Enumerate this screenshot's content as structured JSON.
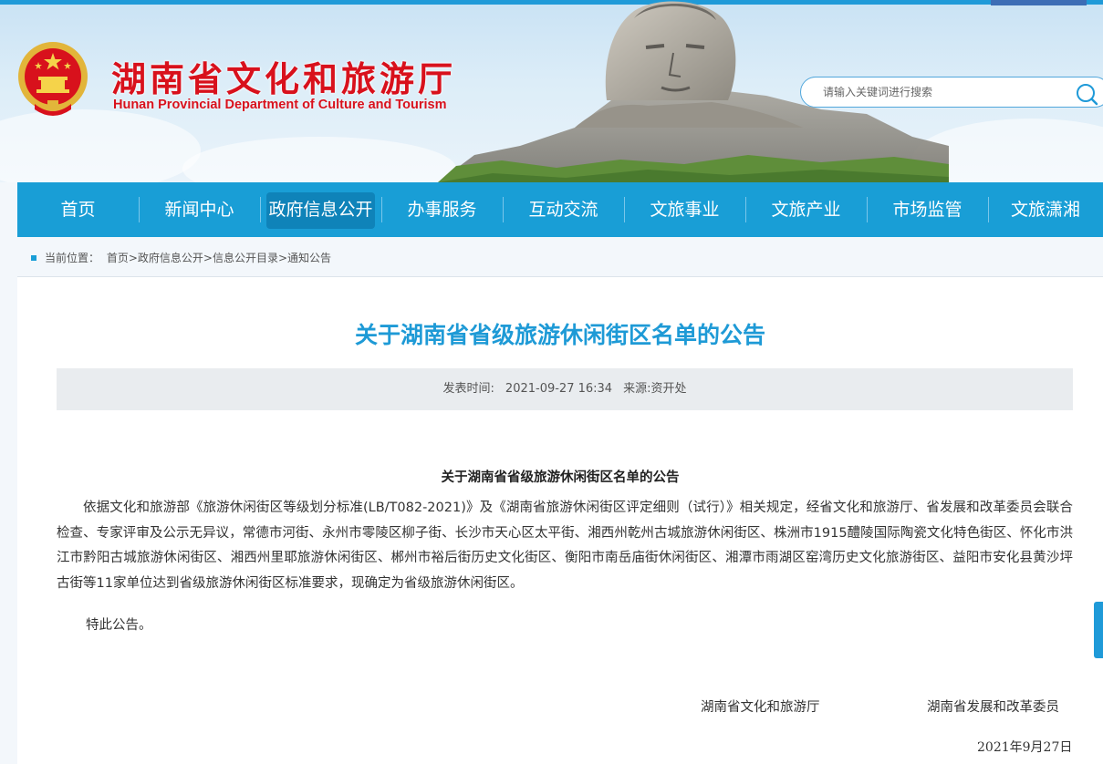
{
  "header": {
    "title_cn": "湖南省文化和旅游厅",
    "title_en": "Hunan Provincial Department of Culture and Tourism"
  },
  "search": {
    "placeholder": "请输入关键词进行搜索"
  },
  "nav": {
    "items": [
      "首页",
      "新闻中心",
      "政府信息公开",
      "办事服务",
      "互动交流",
      "文旅事业",
      "文旅产业",
      "市场监管",
      "文旅潇湘"
    ],
    "active_index": 2
  },
  "breadcrumb": {
    "label": "当前位置：",
    "path": "首页>政府信息公开>信息公开目录>通知公告"
  },
  "article": {
    "title": "关于湖南省省级旅游休闲街区名单的公告",
    "publish_label": "发表时间:",
    "publish_time": "2021-09-27 16:34",
    "source": "来源:资开处",
    "body_title": "关于湖南省省级旅游休闲街区名单的公告",
    "paragraph": "依据文化和旅游部《旅游休闲街区等级划分标准(LB/T082-2021)》及《湖南省旅游休闲街区评定细则（试行）》相关规定，经省文化和旅游厅、省发展和改革委员会联合检查、专家评审及公示无异议，常德市河街、永州市零陵区柳子街、长沙市天心区太平街、湘西州乾州古城旅游休闲街区、株洲市1915醴陵国际陶瓷文化特色街区、怀化市洪江市黔阳古城旅游休闲街区、湘西州里耶旅游休闲街区、郴州市裕后街历史文化街区、衡阳市南岳庙街休闲街区、湘潭市雨湖区窑湾历史文化旅游街区、益阳市安化县黄沙坪古街等11家单位达到省级旅游休闲街区标准要求，现确定为省级旅游休闲街区。",
    "closing": "特此公告。",
    "signer_1": "湖南省文化和旅游厅",
    "signer_2": "湖南省发展和改革委员",
    "date": "2021年9月27日"
  },
  "colors": {
    "brand_red": "#d8111c",
    "nav_blue": "#199ed6",
    "nav_active": "#0f83b9",
    "title_blue": "#1e9ad6"
  },
  "icons": [
    "national-emblem-icon",
    "search-icon"
  ]
}
